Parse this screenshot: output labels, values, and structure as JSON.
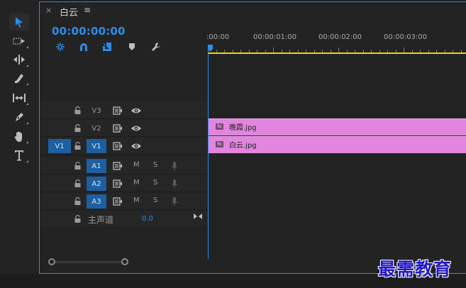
{
  "panel": {
    "close_glyph": "×",
    "sequence_name": "白云",
    "menu_glyph": "≡",
    "timecode": "00:00:00:00"
  },
  "tools": [
    "selection-tool",
    "track-select-forward-tool",
    "ripple-edit-tool",
    "razor-tool",
    "slip-tool",
    "pen-tool",
    "hand-tool",
    "type-tool"
  ],
  "timeline_options": [
    "nest-toggle-icon",
    "snap-icon",
    "linked-selection-icon",
    "add-marker-icon",
    "settings-icon"
  ],
  "ruler": {
    "labels": [
      ":00:00",
      "00:00:01:00",
      "00:00:02:00",
      "00:00:03:00"
    ]
  },
  "tracks": {
    "video": [
      {
        "name": "V3",
        "source": "",
        "selected": false
      },
      {
        "name": "V2",
        "source": "",
        "selected": false
      },
      {
        "name": "V1",
        "source": "V1",
        "selected": true
      }
    ],
    "audio": [
      {
        "name": "A1",
        "mute": "M",
        "solo": "S"
      },
      {
        "name": "A2",
        "mute": "M",
        "solo": "S"
      },
      {
        "name": "A3",
        "mute": "M",
        "solo": "S"
      }
    ],
    "master": {
      "label": "主声道",
      "value": "0.0"
    }
  },
  "clips": [
    {
      "track": "V2",
      "name": "晚霞.jpg",
      "badge": "fx"
    },
    {
      "track": "V1",
      "name": "白云.jpg",
      "badge": "fx"
    }
  ],
  "colors": {
    "accent": "#2d8ceb",
    "clip": "#e285df",
    "work_area": "#e6d31c",
    "track_selected": "#1d5fa0"
  },
  "watermark": "最需教育"
}
